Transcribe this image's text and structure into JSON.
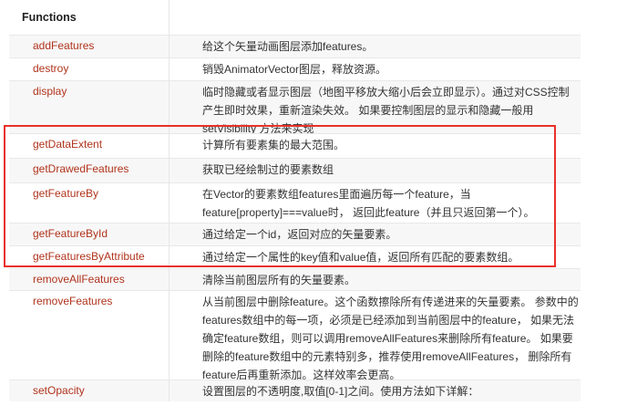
{
  "section_title": "Functions",
  "rows": [
    {
      "name": "addFeatures",
      "desc": [
        "给这个矢量动画图层添加features。"
      ]
    },
    {
      "name": "destroy",
      "desc": [
        "销毁AnimatorVector图层，释放资源。"
      ]
    },
    {
      "name": "display",
      "desc": [
        "临时隐藏或者显示图层（地图平移放大缩小后会立即显示）。通过对CSS控制",
        "产生即时效果，重新渲染失效。 如果要控制图层的显示和隐藏一般用",
        "setVisibility 方法来实现"
      ]
    },
    {
      "name": "getDataExtent",
      "desc": [
        "计算所有要素集的最大范围。"
      ]
    },
    {
      "name": "getDrawedFeatures",
      "desc": [
        "获取已经绘制过的要素数组"
      ]
    },
    {
      "name": "getFeatureBy",
      "desc": [
        "在Vector的要素数组features里面遍历每一个feature，当",
        "feature[property]===value时， 返回此feature（并且只返回第一个）。"
      ]
    },
    {
      "name": "getFeatureById",
      "desc": [
        "通过给定一个id，返回对应的矢量要素。"
      ]
    },
    {
      "name": "getFeaturesByAttribute",
      "desc": [
        "通过给定一个属性的key值和value值，返回所有匹配的要素数组。"
      ]
    },
    {
      "name": "removeAllFeatures",
      "desc": [
        "清除当前图层所有的矢量要素。"
      ]
    },
    {
      "name": "removeFeatures",
      "desc": [
        "从当前图层中删除feature。这个函数擦除所有传递进来的矢量要素。 参数中的",
        "features数组中的每一项，必须是已经添加到当前图层中的feature， 如果无法",
        "确定feature数组，则可以调用removeAllFeatures来删除所有feature。 如果要",
        "删除的feature数组中的元素特别多，推荐使用removeAllFeatures， 删除所有",
        "feature后再重新添加。这样效率会更高。"
      ]
    },
    {
      "name": "setOpacity",
      "desc": [
        "设置图层的不透明度,取值[0-1]之间。使用方法如下详解："
      ]
    }
  ],
  "colors": {
    "link": "#b0331c",
    "highlight": "#e8312b"
  }
}
